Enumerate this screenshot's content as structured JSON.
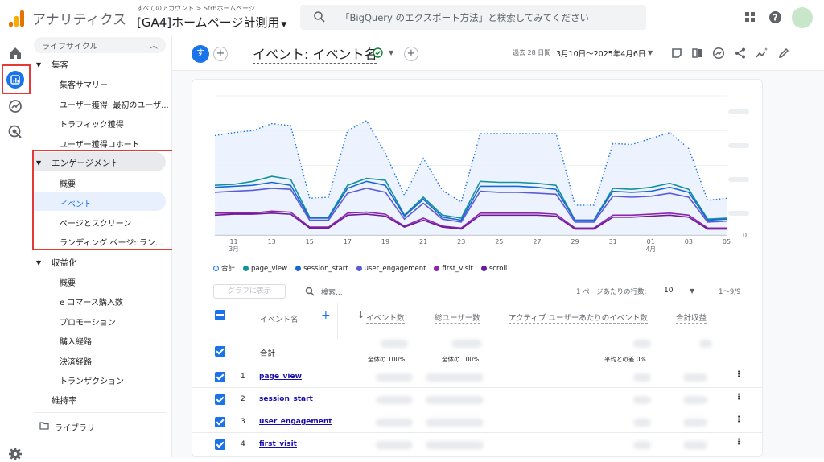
{
  "app": {
    "title": "アナリティクス",
    "breadcrumb": "すべてのアカウント > Strhホームページ",
    "property": "[GA4]ホームページ計測用",
    "search_placeholder": "「BigQuery のエクスポート方法」と検索してみてください"
  },
  "sidebar": {
    "header": "ライフサイクル",
    "sections": [
      {
        "label": "集客",
        "items": [
          "集客サマリー",
          "ユーザー獲得: 最初のユーザ...",
          "トラフィック獲得",
          "ユーザー獲得コホート"
        ]
      },
      {
        "label": "エンゲージメント",
        "items": [
          "概要",
          "イベント",
          "ページとスクリーン",
          "ランディング ページ: ラン..."
        ]
      },
      {
        "label": "収益化",
        "items": [
          "概要",
          "e コマース購入数",
          "プロモーション",
          "購入経路",
          "決済経路",
          "トランザクション"
        ]
      }
    ],
    "retention": "維持率",
    "library": "ライブラリ"
  },
  "header": {
    "avatar_letter": "す",
    "page_title": "イベント: イベント名",
    "date_label": "過去 28 日間",
    "date_range": "3月10日～2025年4月6日"
  },
  "chart_data": {
    "type": "line",
    "x": [
      "3/10",
      "3/11",
      "3/12",
      "3/13",
      "3/14",
      "3/15",
      "3/16",
      "3/17",
      "3/18",
      "3/19",
      "3/20",
      "3/21",
      "3/22",
      "3/23",
      "3/24",
      "3/25",
      "3/26",
      "3/27",
      "3/28",
      "3/29",
      "3/30",
      "3/31",
      "4/1",
      "4/2",
      "4/3",
      "4/4",
      "4/5",
      "4/6"
    ],
    "x_tick_labels": [
      "11\n3月",
      "13",
      "15",
      "17",
      "19",
      "21",
      "23",
      "25",
      "27",
      "29",
      "31",
      "01\n4月",
      "03",
      "05"
    ],
    "y_tick_labels": [
      "0"
    ],
    "series": [
      {
        "name": "合計",
        "color": "#1a73e8",
        "values": [
          100,
          103,
          105,
          112,
          110,
          37,
          38,
          105,
          115,
          82,
          40,
          77,
          45,
          33,
          102,
          102,
          102,
          102,
          102,
          30,
          30,
          92,
          91,
          97,
          103,
          87,
          35,
          37
        ]
      },
      {
        "name": "page_view",
        "color": "#12939a",
        "values": [
          50,
          51,
          54,
          59,
          56,
          18,
          18,
          50,
          57,
          55,
          20,
          38,
          20,
          17,
          54,
          53,
          53,
          52,
          50,
          15,
          15,
          47,
          46,
          48,
          52,
          46,
          16,
          17
        ]
      },
      {
        "name": "session_start",
        "color": "#1967d2",
        "values": [
          48,
          49,
          50,
          53,
          50,
          17,
          17,
          47,
          54,
          50,
          19,
          36,
          18,
          15,
          49,
          49,
          49,
          48,
          46,
          15,
          15,
          44,
          43,
          44,
          48,
          43,
          15,
          16
        ]
      },
      {
        "name": "user_engagement",
        "color": "#5b5bd6",
        "values": [
          43,
          44,
          45,
          47,
          46,
          15,
          15,
          42,
          47,
          43,
          16,
          32,
          16,
          13,
          44,
          43,
          43,
          42,
          41,
          13,
          13,
          39,
          38,
          39,
          42,
          38,
          13,
          14
        ]
      },
      {
        "name": "first_visit",
        "color": "#8e24aa",
        "values": [
          22,
          22,
          22,
          24,
          23,
          8,
          8,
          22,
          23,
          21,
          9,
          17,
          9,
          7,
          22,
          22,
          22,
          22,
          21,
          7,
          7,
          20,
          20,
          21,
          22,
          20,
          7,
          7
        ]
      },
      {
        "name": "scroll",
        "color": "#6a1b9a",
        "values": [
          20,
          21,
          21,
          22,
          21,
          7,
          7,
          20,
          21,
          19,
          8,
          15,
          8,
          6,
          20,
          20,
          20,
          20,
          19,
          6,
          6,
          18,
          18,
          19,
          20,
          18,
          6,
          6
        ]
      }
    ]
  },
  "table": {
    "plot_button": "グラフに表示",
    "search_placeholder": "検索...",
    "rows_per_page_label": "1 ページあたりの行数:",
    "rows_per_page": "10",
    "pagination": "1～9/9",
    "columns": [
      "イベント名",
      "イベント数",
      "総ユーザー数",
      "アクティブ ユーザーあたりのイベント数",
      "合計収益"
    ],
    "total_label": "合計",
    "total_subs": [
      "全体の 100%",
      "全体の 100%",
      "平均との差 0%"
    ],
    "rows": [
      {
        "num": "1",
        "name": "page_view"
      },
      {
        "num": "2",
        "name": "session_start"
      },
      {
        "num": "3",
        "name": "user_engagement"
      },
      {
        "num": "4",
        "name": "first_visit"
      }
    ]
  },
  "colors": {
    "accent": "#1a73e8",
    "highlight": "#e53935",
    "selected_bg": "#e8f0fe"
  }
}
